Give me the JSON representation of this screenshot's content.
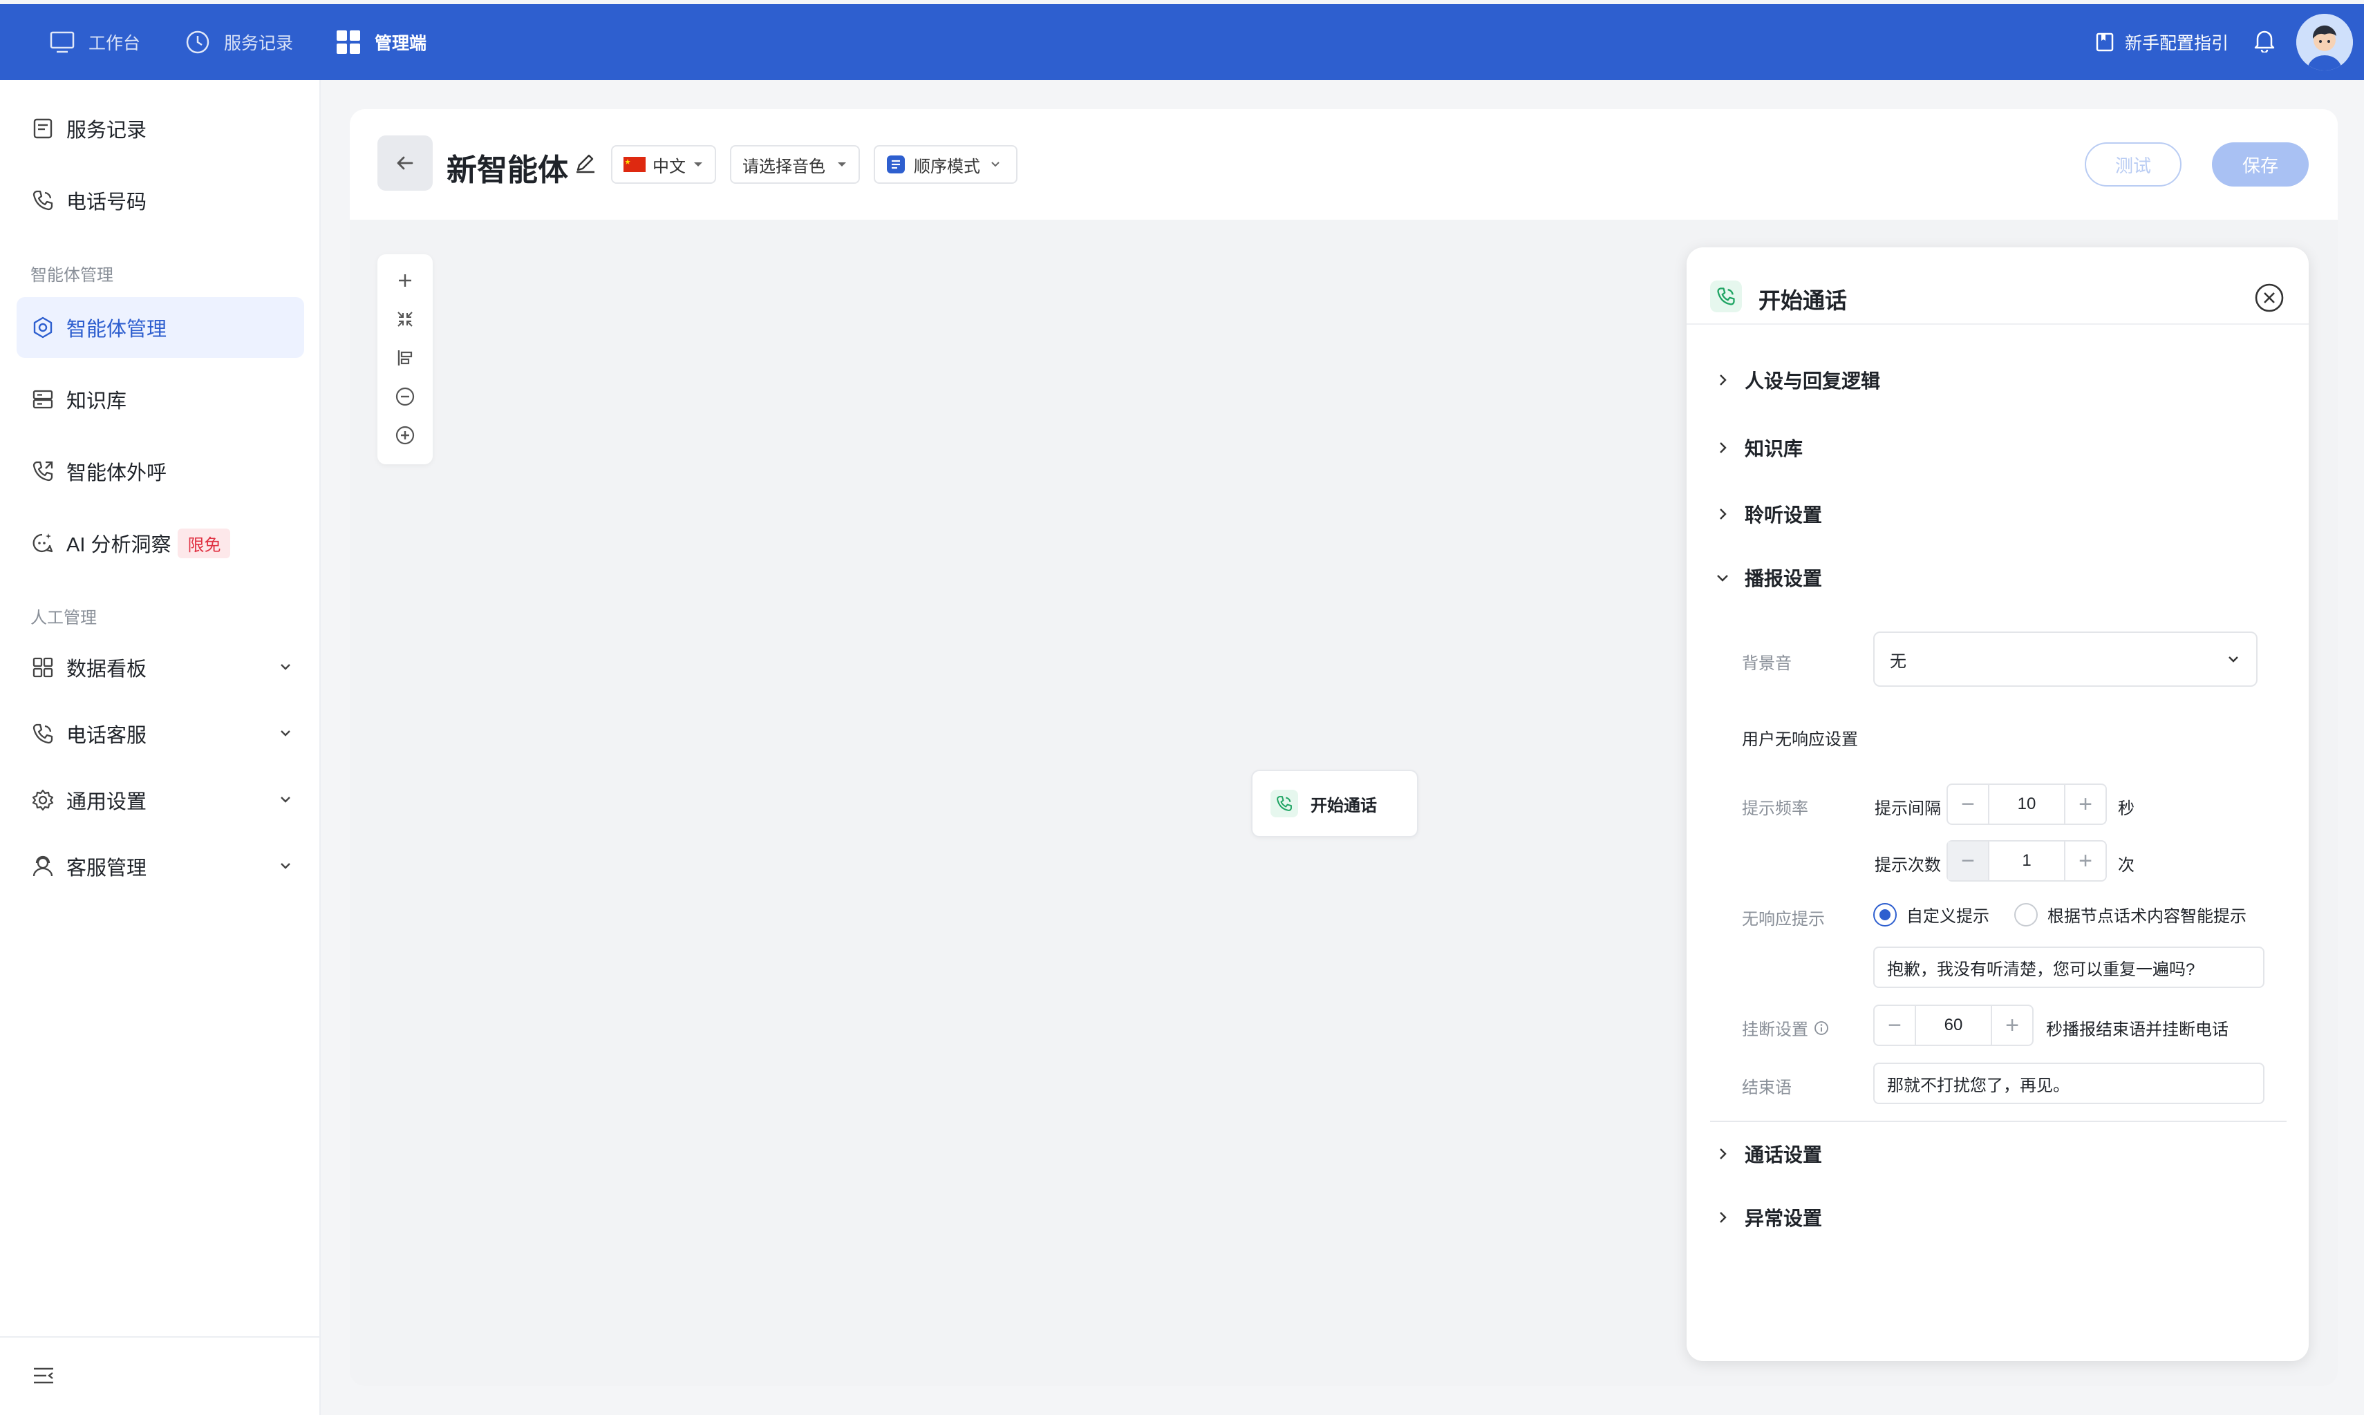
{
  "topbar": {
    "items": [
      {
        "label": "工作台",
        "icon": "monitor-icon"
      },
      {
        "label": "服务记录",
        "icon": "clock-icon"
      },
      {
        "label": "管理端",
        "icon": "grid-icon"
      }
    ],
    "guide_label": "新手配置指引"
  },
  "sidebar": {
    "items": [
      {
        "label": "服务记录"
      },
      {
        "label": "电话号码"
      }
    ],
    "group_agent": "智能体管理",
    "agent_items": [
      {
        "label": "智能体管理"
      },
      {
        "label": "知识库"
      },
      {
        "label": "智能体外呼"
      },
      {
        "label": "AI 分析洞察",
        "badge": "限免"
      }
    ],
    "group_manual": "人工管理",
    "manual_items": [
      {
        "label": "数据看板"
      },
      {
        "label": "电话客服"
      },
      {
        "label": "通用设置"
      },
      {
        "label": "客服管理"
      }
    ]
  },
  "header": {
    "title": "新智能体",
    "language": "中文",
    "voice_placeholder": "请选择音色",
    "mode": "顺序模式",
    "test_label": "测试",
    "save_label": "保存"
  },
  "canvas": {
    "node_label": "开始通话"
  },
  "panel": {
    "title": "开始通话",
    "sections": {
      "persona": "人设与回复逻辑",
      "knowledge": "知识库",
      "listen": "聆听设置",
      "broadcast": "播报设置",
      "call": "通话设置",
      "exception": "异常设置"
    },
    "bg_sound_label": "背景音",
    "bg_sound_value": "无",
    "no_response_title": "用户无响应设置",
    "freq_label": "提示频率",
    "interval_label": "提示间隔",
    "interval_value": "10",
    "interval_unit": "秒",
    "count_label": "提示次数",
    "count_value": "1",
    "count_unit": "次",
    "prompt_label": "无响应提示",
    "radio_custom": "自定义提示",
    "radio_smart": "根据节点话术内容智能提示",
    "prompt_text": "抱歉，我没有听清楚，您可以重复一遍吗?",
    "hangup_label": "挂断设置",
    "hangup_value": "60",
    "hangup_suffix": "秒播报结束语并挂断电话",
    "ending_label": "结束语",
    "ending_text": "那就不打扰您了，再见。"
  },
  "colors": {
    "brand": "#2e5fcf",
    "panel_bg": "#ffffff",
    "canvas_bg": "#f2f3f5",
    "badge_bg": "#fde8ea",
    "badge_text": "#e03142"
  }
}
